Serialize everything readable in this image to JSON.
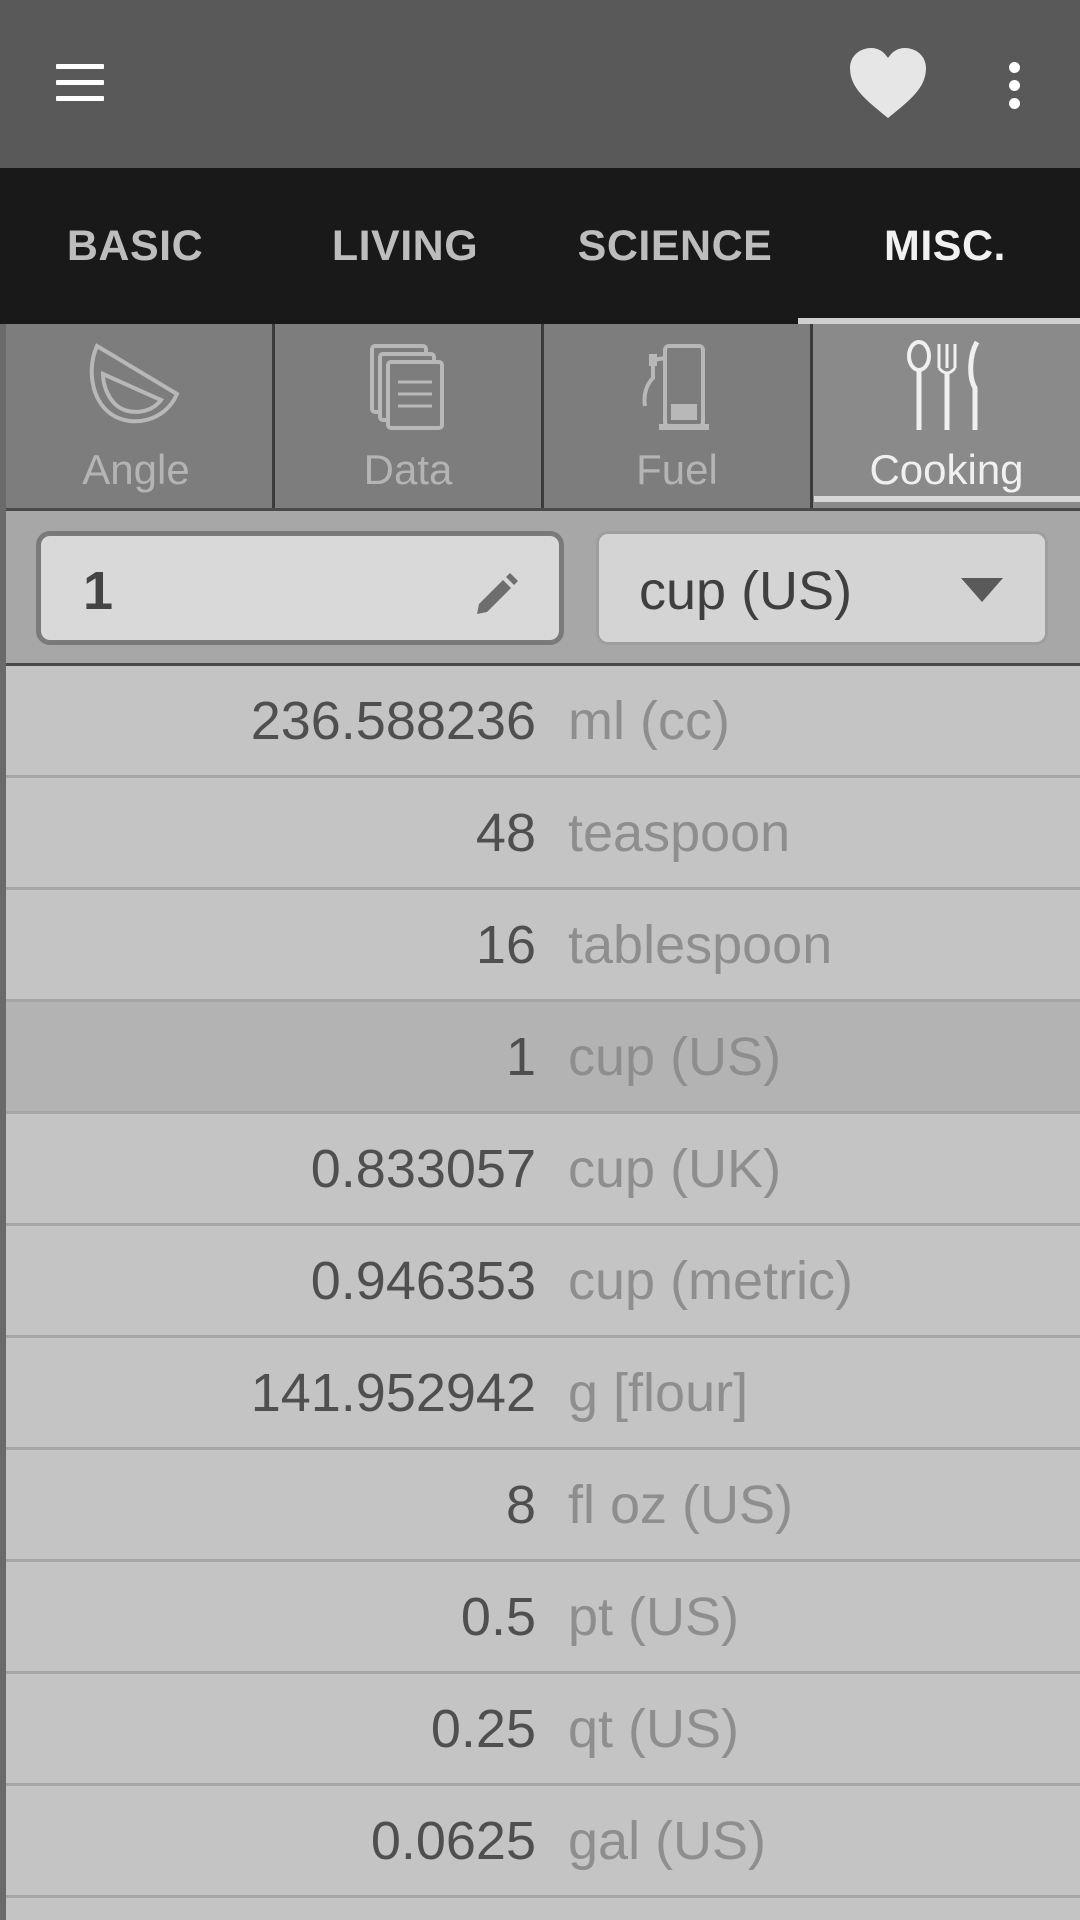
{
  "colors": {
    "appbar": "#595959",
    "tabbar": "#191919",
    "accent": "#d8d8d8"
  },
  "appbar": {
    "menu_icon": "hamburger-menu-icon",
    "favorite_icon": "heart-icon",
    "more_icon": "more-vertical-icon"
  },
  "category_tabs": [
    {
      "label": "BASIC"
    },
    {
      "label": "LIVING"
    },
    {
      "label": "SCIENCE"
    },
    {
      "label": "MISC.",
      "active": true
    }
  ],
  "sub_tabs": [
    {
      "label": "Angle",
      "icon": "angle-icon"
    },
    {
      "label": "Data",
      "icon": "data-icon"
    },
    {
      "label": "Fuel",
      "icon": "fuel-pump-icon"
    },
    {
      "label": "Cooking",
      "icon": "cutlery-icon",
      "active": true
    }
  ],
  "input": {
    "value": "1",
    "edit_icon": "pencil-icon"
  },
  "unit_select": {
    "selected": "cup (US)",
    "caret_icon": "dropdown-triangle-icon"
  },
  "results": [
    {
      "value": "236.588236",
      "unit": "ml (cc)"
    },
    {
      "value": "48",
      "unit": "teaspoon"
    },
    {
      "value": "16",
      "unit": "tablespoon"
    },
    {
      "value": "1",
      "unit": "cup (US)",
      "selected": true
    },
    {
      "value": "0.833057",
      "unit": "cup (UK)"
    },
    {
      "value": "0.946353",
      "unit": "cup (metric)"
    },
    {
      "value": "141.952942",
      "unit": "g [flour]"
    },
    {
      "value": "8",
      "unit": "fl oz (US)"
    },
    {
      "value": "0.5",
      "unit": "pt (US)"
    },
    {
      "value": "0.25",
      "unit": "qt (US)"
    },
    {
      "value": "0.0625",
      "unit": "gal (US)"
    }
  ]
}
